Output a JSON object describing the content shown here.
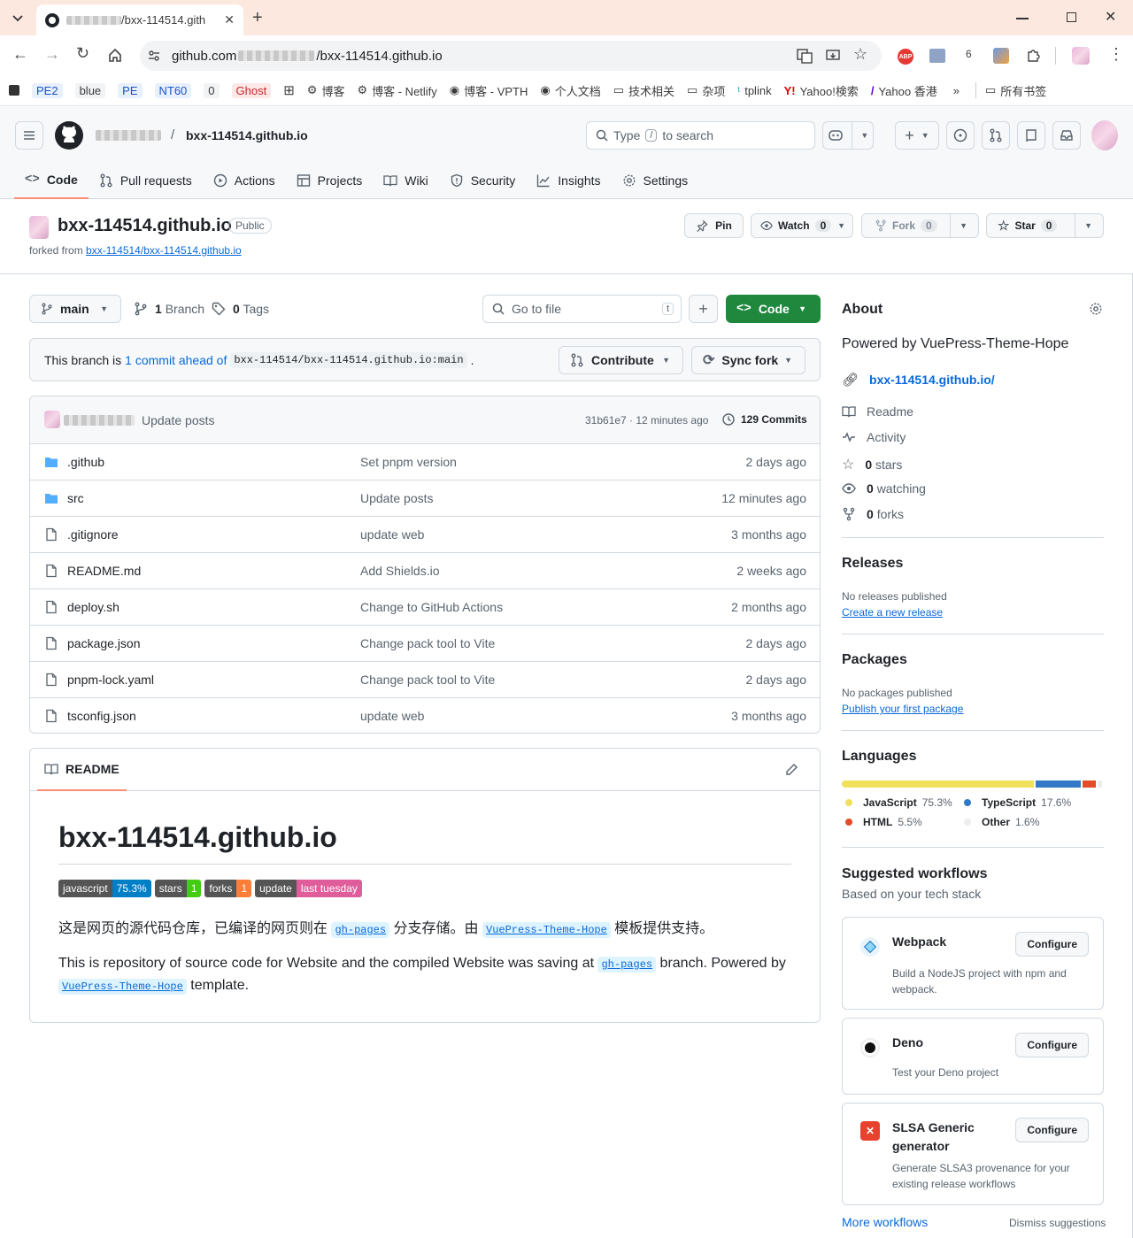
{
  "browser": {
    "tab_title": "/bxx-114514.gith",
    "url_host": "github.com",
    "url_path": "/bxx-114514.github.io",
    "bookmarks": [
      {
        "label": "PE2",
        "chip": true
      },
      {
        "label": "blue",
        "chip": false
      },
      {
        "label": "PE",
        "chip": true
      },
      {
        "label": "NT60",
        "chip": true
      },
      {
        "label": "0",
        "chip": false
      },
      {
        "label": "Ghost",
        "chip": false
      },
      {
        "label": "博客",
        "chip": false
      },
      {
        "label": "博客 - Netlify",
        "chip": false
      },
      {
        "label": "博客 - VPTH",
        "chip": false
      },
      {
        "label": "个人文档",
        "chip": false
      },
      {
        "label": "技术相关",
        "chip": false
      },
      {
        "label": "杂项",
        "chip": false
      },
      {
        "label": "tplink",
        "chip": false
      },
      {
        "label": "Yahoo!検索",
        "chip": false
      },
      {
        "label": "Yahoo 香港",
        "chip": false
      }
    ],
    "all_bookmarks": "所有书签",
    "ext_icon_label": "6"
  },
  "header": {
    "repo_name": "bxx-114514.github.io",
    "separator": "/",
    "search_prefix": "Type",
    "search_key": "/",
    "search_suffix": "to search"
  },
  "nav": {
    "tabs": [
      "Code",
      "Pull requests",
      "Actions",
      "Projects",
      "Wiki",
      "Security",
      "Insights",
      "Settings"
    ]
  },
  "repo": {
    "title": "bxx-114514.github.io",
    "visibility": "Public",
    "forked_from_label": "forked from",
    "forked_from": "bxx-114514/bxx-114514.github.io",
    "pin": "Pin",
    "watch": "Watch",
    "watch_count": "0",
    "fork": "Fork",
    "fork_count": "0",
    "star": "Star",
    "star_count": "0"
  },
  "toolbar": {
    "branch": "main",
    "branches": "1 Branch",
    "branches_num": "1",
    "branches_word": "Branch",
    "tags_num": "0",
    "tags_word": "Tags",
    "go_to_file": "Go to file",
    "go_to_file_key": "t",
    "code_button": "Code"
  },
  "ahead": {
    "prefix": "This branch is",
    "link": "1 commit ahead of",
    "ref": "bxx-114514/bxx-114514.github.io:main",
    "suffix": ".",
    "contribute": "Contribute",
    "sync": "Sync fork"
  },
  "commit": {
    "message": "Update posts",
    "hash_time": "31b61e7 · 12 minutes ago",
    "commits": "129 Commits"
  },
  "files": [
    {
      "name": ".github",
      "type": "dir",
      "message": "Set pnpm version",
      "date": "2 days ago"
    },
    {
      "name": "src",
      "type": "dir",
      "message": "Update posts",
      "date": "12 minutes ago"
    },
    {
      "name": ".gitignore",
      "type": "file",
      "message": "update web",
      "date": "3 months ago"
    },
    {
      "name": "README.md",
      "type": "file",
      "message": "Add Shields.io",
      "date": "2 weeks ago"
    },
    {
      "name": "deploy.sh",
      "type": "file",
      "message": "Change to GitHub Actions",
      "date": "2 months ago"
    },
    {
      "name": "package.json",
      "type": "file",
      "message": "Change pack tool to Vite",
      "date": "2 days ago"
    },
    {
      "name": "pnpm-lock.yaml",
      "type": "file",
      "message": "Change pack tool to Vite",
      "date": "2 days ago"
    },
    {
      "name": "tsconfig.json",
      "type": "file",
      "message": "update web",
      "date": "3 months ago"
    }
  ],
  "readme": {
    "tab": "README",
    "heading": "bxx-114514.github.io",
    "badges": [
      {
        "left": "javascript",
        "right": "75.3%",
        "color": "#007ec6"
      },
      {
        "left": "stars",
        "right": "1",
        "color": "#4c1"
      },
      {
        "left": "forks",
        "right": "1",
        "color": "#fe7d37"
      },
      {
        "left": "update",
        "right": "last tuesday",
        "color": "#e05d9c"
      }
    ],
    "zh_p1": "这是网页的源代码仓库，已编译的网页则在",
    "zh_code1": "gh-pages",
    "zh_p2": "分支存储。由",
    "zh_code2": "VuePress-Theme-Hope",
    "zh_p3": "模板提供支持。",
    "en_p1": "This is repository of source code for Website and the compiled Website was saving at",
    "en_code1": "gh-pages",
    "en_p2": "branch. Powered by",
    "en_code2": "VuePress-Theme-Hope",
    "en_p3": "template."
  },
  "about": {
    "title": "About",
    "description": "Powered by VuePress-Theme-Hope",
    "website": "bxx-114514.github.io/",
    "readme": "Readme",
    "activity": "Activity",
    "stars": "0 stars",
    "stars_num": "0",
    "stars_word": "stars",
    "watching_num": "0",
    "watching_word": "watching",
    "forks_num": "0",
    "forks_word": "forks"
  },
  "releases": {
    "title": "Releases",
    "none": "No releases published",
    "link": "Create a new release"
  },
  "packages": {
    "title": "Packages",
    "none": "No packages published",
    "link": "Publish your first package"
  },
  "languages": {
    "title": "Languages",
    "items": [
      {
        "name": "JavaScript",
        "percent": 75.3,
        "label": "75.3%",
        "color": "#f1e05a"
      },
      {
        "name": "TypeScript",
        "percent": 17.6,
        "label": "17.6%",
        "color": "#3178c6"
      },
      {
        "name": "HTML",
        "percent": 5.5,
        "label": "5.5%",
        "color": "#e34c26"
      },
      {
        "name": "Other",
        "percent": 1.6,
        "label": "1.6%",
        "color": "#ededed"
      }
    ]
  },
  "workflows": {
    "title": "Suggested workflows",
    "subtitle": "Based on your tech stack",
    "items": [
      {
        "name": "Webpack",
        "desc": "Build a NodeJS project with npm and webpack.",
        "button": "Configure"
      },
      {
        "name": "Deno",
        "desc": "Test your Deno project",
        "button": "Configure"
      },
      {
        "name": "SLSA Generic generator",
        "desc": "Generate SLSA3 provenance for your existing release workflows",
        "button": "Configure"
      }
    ],
    "more": "More workflows",
    "dismiss": "Dismiss suggestions"
  }
}
